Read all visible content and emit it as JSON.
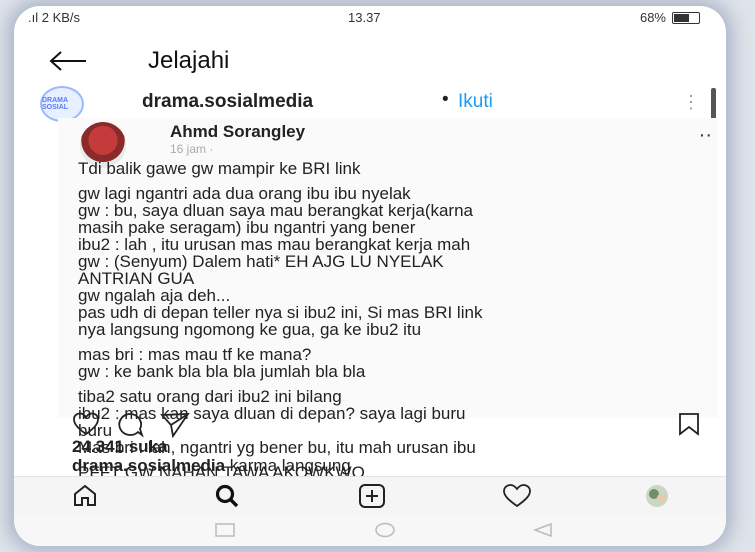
{
  "status_bar": {
    "network": ".ıl 2 KB/s",
    "time": "13.37",
    "battery": "68%",
    "battery_level": 0.68
  },
  "header": {
    "title": "Jelajahi"
  },
  "post": {
    "avatar_text": "DRAMA SOSIAL",
    "account": "drama.sosialmedia",
    "separator": "•",
    "follow_label": "Ikuti"
  },
  "screenshot_post": {
    "author": "Ahmd Sorangley",
    "time": "16 jam · ",
    "lines": [
      "Tdi balik gawe gw mampir ke BRI link",
      "gw lagi ngantri ada dua orang ibu ibu nyelak",
      "gw : bu, saya dluan saya mau berangkat kerja(karna",
      "masih pake seragam) ibu ngantri yang bener",
      "ibu2 : lah , itu urusan mas mau berangkat kerja mah",
      "gw : (Senyum) Dalem hati* EH AJG LU NYELAK",
      "ANTRIAN GUA",
      "gw ngalah aja deh...",
      "pas udh di depan teller nya si ibu2 ini, Si mas BRI link",
      "nya langsung ngomong ke gua, ga ke ibu2 itu",
      "mas bri : mas mau tf ke mana?",
      "gw : ke bank bla bla bla jumlah bla bla",
      "tiba2 satu orang dari ibu2 ini bilang",
      "ibu2 : mas kan saya dluan di depan? saya lagi buru",
      "buru",
      "Mas bri : lah, ngantri yg bener bu, itu mah urusan ibu",
      "PFFT GW NAHAN TAWA AKOWKWO"
    ]
  },
  "likes": "24.341 suka",
  "caption": {
    "account": "drama.sosialmedia",
    "text": " karma langsung"
  },
  "colors": {
    "accent": "#1a9cf0",
    "text": "#222222"
  }
}
